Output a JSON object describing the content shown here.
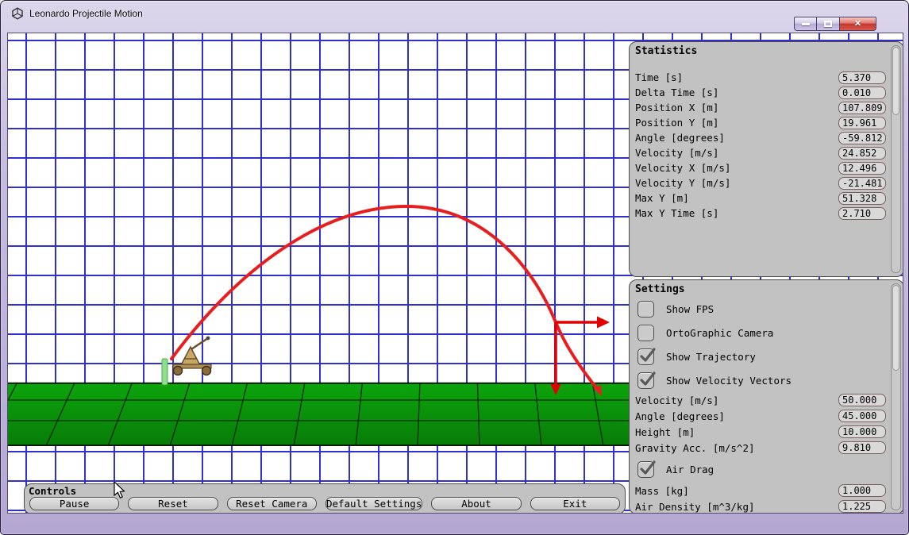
{
  "window": {
    "title": "Leonardo Projectile Motion"
  },
  "statistics": {
    "title": "Statistics",
    "rows": [
      {
        "label": "Time [s]",
        "value": "5.370"
      },
      {
        "label": "Delta Time [s]",
        "value": "0.010"
      },
      {
        "label": "Position X [m]",
        "value": "107.809"
      },
      {
        "label": "Position Y [m]",
        "value": "19.961"
      },
      {
        "label": "Angle [degrees]",
        "value": "-59.812"
      },
      {
        "label": "Velocity [m/s]",
        "value": "24.852"
      },
      {
        "label": "Velocity X [m/s]",
        "value": "12.496"
      },
      {
        "label": "Velocity Y [m/s]",
        "value": "-21.481"
      },
      {
        "label": "Max Y [m]",
        "value": "51.328"
      },
      {
        "label": "Max Y Time [s]",
        "value": "2.710"
      }
    ]
  },
  "settings": {
    "title": "Settings",
    "toggles": [
      {
        "label": "Show FPS",
        "checked": false
      },
      {
        "label": "OrtoGraphic Camera",
        "checked": false
      },
      {
        "label": "Show Trajectory",
        "checked": true
      },
      {
        "label": "Show Velocity Vectors",
        "checked": true
      }
    ],
    "fields": [
      {
        "label": "Velocity [m/s]",
        "value": "50.000"
      },
      {
        "label": "Angle [degrees]",
        "value": "45.000"
      },
      {
        "label": "Height [m]",
        "value": "10.000"
      },
      {
        "label": "Gravity Acc. [m/s^2]",
        "value": "9.810"
      }
    ],
    "air_drag": {
      "label": "Air Drag",
      "checked": true
    },
    "fields2": [
      {
        "label": "Mass [kg]",
        "value": "1.000"
      },
      {
        "label": "Air Density [m^3/kg]",
        "value": "1.225"
      }
    ]
  },
  "controls": {
    "title": "Controls",
    "buttons": [
      "Pause",
      "Reset",
      "Reset Camera",
      "Default Settings",
      "About",
      "Exit"
    ]
  },
  "colors": {
    "trajectory": "#e81e1e",
    "vector": "#e00000",
    "ground": "#0a9a0a",
    "grid_line": "#2f2fd2",
    "panel_bg": "#c2c2c2"
  }
}
